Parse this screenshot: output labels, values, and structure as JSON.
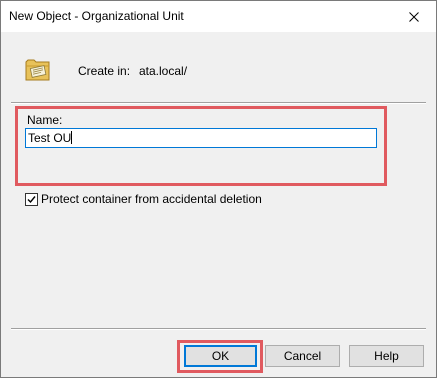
{
  "window": {
    "title": "New Object - Organizational Unit"
  },
  "header": {
    "icon": "organizational-unit-folder-icon",
    "create_in_label": "Create in:",
    "create_in_value": "ata.local/"
  },
  "form": {
    "name_label": "Name:",
    "name_value": "Test OU",
    "protect_label": "Protect container from accidental deletion",
    "protect_checked": true
  },
  "buttons": {
    "ok_label": "OK",
    "cancel_label": "Cancel",
    "help_label": "Help"
  },
  "colors": {
    "highlight": "#e05a5f",
    "focus": "#0078d7",
    "dialog_bg": "#f0f0f0"
  }
}
